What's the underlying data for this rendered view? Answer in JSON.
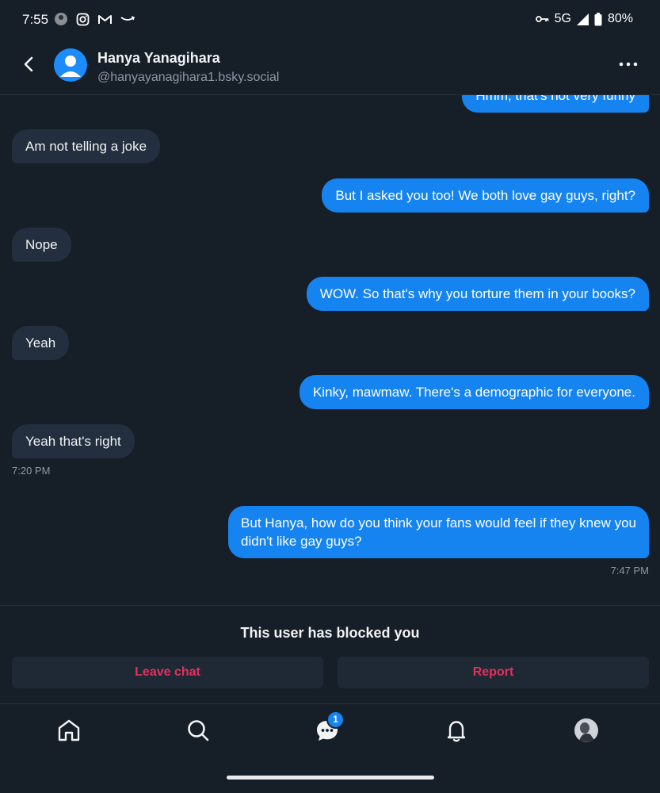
{
  "status_bar": {
    "time": "7:55",
    "network": "5G",
    "battery": "80%"
  },
  "header": {
    "name": "Hanya Yanagihara",
    "handle": "@hanyayanagihara1.bsky.social"
  },
  "messages": [
    {
      "direction": "out",
      "text": "Hmm, that's not very funny"
    },
    {
      "direction": "in",
      "text": "Am not telling a joke"
    },
    {
      "direction": "out",
      "text": "But I asked you too! We both love gay guys, right?"
    },
    {
      "direction": "in",
      "text": "Nope"
    },
    {
      "direction": "out",
      "text": "WOW. So that's why you torture them in your books?"
    },
    {
      "direction": "in",
      "text": "Yeah"
    },
    {
      "direction": "out",
      "text": "Kinky, mawmaw. There's a demographic for everyone."
    },
    {
      "direction": "in",
      "text": "Yeah that's right"
    },
    {
      "direction": "out",
      "text_line1": "But Hanya, how do you think your fans would feel if they knew you",
      "text_line2": "didn't like gay guys?"
    }
  ],
  "timestamps": {
    "incoming_last": "7:20 PM",
    "outgoing_last": "7:47 PM"
  },
  "blocked": {
    "message": "This user has blocked you",
    "leave_label": "Leave chat",
    "report_label": "Report"
  },
  "nav": {
    "messages_badge": "1"
  },
  "colors": {
    "background": "#161e27",
    "incoming_bubble": "#232f3e",
    "outgoing_bubble": "#1583f0",
    "danger": "#e0315d",
    "accent": "#1c8cfc"
  },
  "icons": [
    "back-arrow-icon",
    "user-avatar-icon",
    "more-options-icon",
    "home-icon",
    "search-icon",
    "chat-icon",
    "bell-icon",
    "profile-avatar-icon"
  ]
}
